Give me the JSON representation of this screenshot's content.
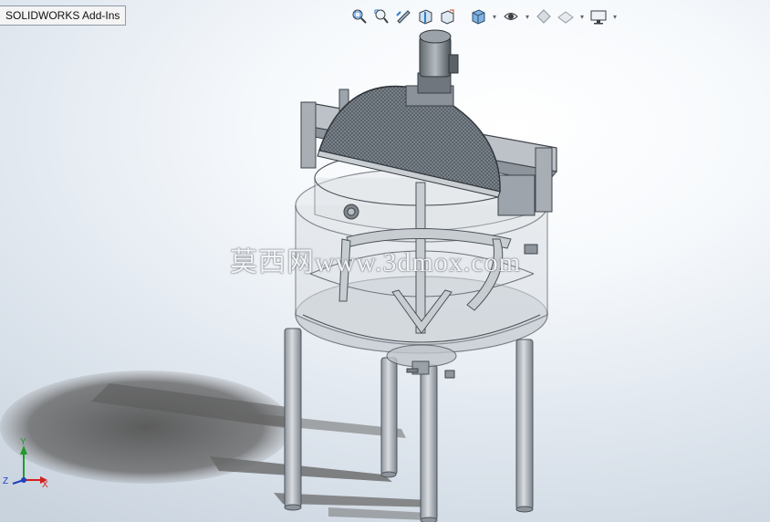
{
  "tab": {
    "label": "SOLIDWORKS Add-Ins"
  },
  "toolbar": {
    "items": [
      {
        "icon": "zoom-to-fit-icon"
      },
      {
        "icon": "zoom-to-area-icon"
      },
      {
        "icon": "previous-view-icon"
      },
      {
        "icon": "section-view-icon"
      },
      {
        "icon": "dynamic-annotation-view-icon"
      },
      {
        "icon": "view-orientation-icon",
        "dropdown": true
      },
      {
        "icon": "display-style-icon",
        "dropdown": true
      },
      {
        "icon": "hide-show-items-icon",
        "dropdown": true
      },
      {
        "icon": "edit-appearance-icon"
      },
      {
        "icon": "apply-scene-icon",
        "dropdown": true
      },
      {
        "icon": "view-settings-icon",
        "dropdown": true
      }
    ]
  },
  "watermark": {
    "text": "莫西网www.3dmox.com"
  },
  "triad": {
    "x_label": "X",
    "y_label": "Y",
    "z_label": "Z"
  },
  "colors": {
    "accent_x": "#d22020",
    "accent_y": "#1f9a2a",
    "accent_z": "#2040c0"
  }
}
